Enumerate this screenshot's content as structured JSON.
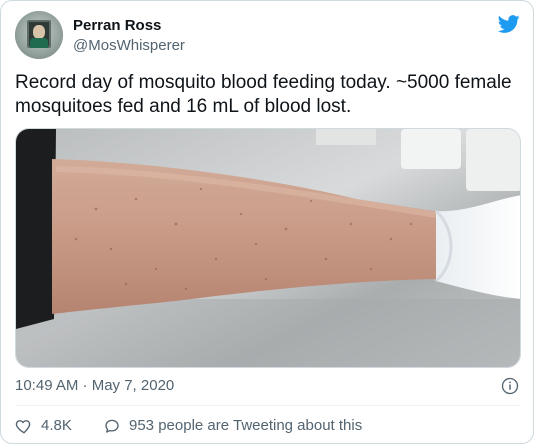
{
  "tweet": {
    "author": {
      "name": "Perran Ross",
      "handle": "@MosWhisperer"
    },
    "text": "Record day of mosquito blood feeding today. ~5000 female mosquitoes fed and 16 mL of blood lost.",
    "timestamp": "10:49 AM · May 7, 2020",
    "likes": "4.8K",
    "tweeting_about": "953 people are Tweeting about this"
  },
  "icons": {
    "brand": "twitter-bird-icon",
    "info": "info-icon",
    "like": "heart-icon",
    "reply": "speech-bubble-icon"
  },
  "colors": {
    "brand_blue": "#1d9bf0",
    "text_primary": "#0f1419",
    "text_secondary": "#536471",
    "border": "#cfd9de"
  }
}
